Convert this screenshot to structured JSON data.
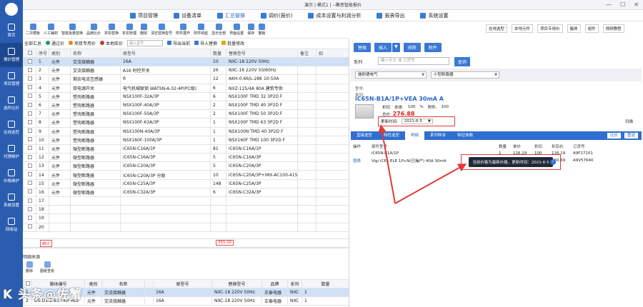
{
  "title": "演示 | 模式1 | --聚思智能报价",
  "window_controls": [
    "—",
    "☐",
    "✕"
  ],
  "sidebar": {
    "items": [
      {
        "label": "首页"
      },
      {
        "label": "报价管理"
      },
      {
        "label": "项目管理"
      },
      {
        "label": "选件比价"
      },
      {
        "label": "在线选型"
      },
      {
        "label": "代理维护"
      },
      {
        "label": "价格维护"
      },
      {
        "label": "系统设置"
      },
      {
        "label": "回收站"
      }
    ]
  },
  "menu": {
    "items": [
      {
        "label": "项目管理"
      },
      {
        "label": "设备清单"
      },
      {
        "label": "汇总替换"
      },
      {
        "label": "调价(报价)"
      },
      {
        "label": "成本设置与利润分析"
      },
      {
        "label": "报表导出"
      },
      {
        "label": "系统设置"
      }
    ],
    "active_index": 2
  },
  "toolbar": {
    "items": [
      "二次模板",
      "人工辅材",
      "智能批量替换",
      "品牌比价",
      "折扣替换",
      "折扣管理",
      "删除",
      "清空替换型号",
      "附件展开",
      "附件收起",
      "显示全部",
      "界面设置",
      "保存",
      "撤销"
    ]
  },
  "right_tools": [
    "在线选型",
    "本地元件",
    "项目专用价",
    "箱体",
    "组件",
    "视频教程"
  ],
  "filterbar": {
    "all": "全部汇总",
    "items": [
      "通过价",
      "项目专用价",
      "本地库价"
    ],
    "input_placeholder": "输入型号",
    "actions": [
      "导出当前",
      "导入替换",
      "批量修改"
    ]
  },
  "main_table": {
    "headers": [
      "",
      "序号",
      "类别",
      "名称",
      "原型号",
      "数量",
      "替换型号",
      "备注",
      "招"
    ],
    "rows": [
      [
        "1",
        "元件",
        "交流接触器",
        "16A",
        "10",
        "NXC-18 220V 50Hz",
        "",
        ""
      ],
      [
        "2",
        "元件",
        "交流接触器",
        "A16 时控开关",
        "26",
        "NXC-16 220V 50/60Hz",
        "",
        ""
      ],
      [
        "3",
        "元件",
        "剩余电流互感器",
        "R",
        "12",
        "AKH-0.66/L-28K 10-50A",
        "",
        ""
      ],
      [
        "4",
        "元件",
        "双电源开关",
        "电气机械联锁 WATSN-A-32-4P(PC级)",
        "6",
        "NXZ-125/4A 80A 建筑专供",
        "",
        ""
      ],
      [
        "5",
        "元件",
        "塑壳断路器",
        "NSX100F-32A/3P",
        "6",
        "NSX100F TMD 32 3P2D F",
        "",
        ""
      ],
      [
        "6",
        "元件",
        "塑壳断路器",
        "NSX100F-40A/3P",
        "2",
        "NSX100F TMD 40 3P2D F",
        "",
        ""
      ],
      [
        "7",
        "元件",
        "塑壳断路器",
        "NSX100F-50A/3P",
        "2",
        "NSX100F TMD 50 3P2D F",
        "",
        ""
      ],
      [
        "8",
        "元件",
        "塑壳断路器",
        "NSX100F-63A/3P",
        "1",
        "NSX100F TMD 63 3P2D F",
        "",
        ""
      ],
      [
        "9",
        "元件",
        "塑壳断路器",
        "NSX100N-40A/3P",
        "1",
        "NSX100N TMD 40 3P2D F",
        "",
        ""
      ],
      [
        "10",
        "元件",
        "塑壳断路器",
        "NSX160F-100A/3P",
        "1",
        "NSX160F TMD 100 3P2D F",
        "",
        ""
      ],
      [
        "11",
        "元件",
        "微型断路器",
        "iC65N-C16A/1P",
        "81",
        "iC65N-C16A/1P",
        "",
        ""
      ],
      [
        "12",
        "元件",
        "微型断路器",
        "iC65N-C16A/3P",
        "5",
        "iC65N-C16A/3P",
        "",
        ""
      ],
      [
        "13",
        "元件",
        "微型断路器",
        "iC65N-C20A/3P",
        "5",
        "iC65N-C20A/3P",
        "",
        ""
      ],
      [
        "14",
        "元件",
        "微型断路器",
        "iC65N-C20A/3P 分励",
        "10",
        "iC65N-C20A/3P+iMX-AC100-415",
        "",
        ""
      ],
      [
        "15",
        "元件",
        "微型断路器",
        "iC65N-C25A/3P",
        "148",
        "iC65N-C25A/3P",
        "",
        ""
      ],
      [
        "16",
        "元件",
        "微型断路器",
        "iC65N-C32A/3P",
        "6",
        "iC65N-C32A/3P",
        "",
        ""
      ],
      [
        "17",
        "",
        "",
        "",
        "",
        "",
        "",
        ""
      ],
      [
        "18",
        "",
        "",
        "",
        "",
        "",
        "",
        ""
      ],
      [
        "19",
        "",
        "",
        "",
        "",
        "",
        "",
        ""
      ],
      [
        "20",
        "",
        "",
        "",
        "",
        "",
        "",
        ""
      ]
    ],
    "selected_index": 0,
    "footer_left": "统计",
    "footer_mid": "355.00"
  },
  "lower": {
    "title": "明细来源",
    "tools": [
      "删除",
      "图纸查看"
    ],
    "headers": [
      "",
      "箱体编号",
      "类别",
      "名称",
      "",
      "原型号",
      "替换型号",
      "品牌",
      "系列",
      "数量"
    ],
    "rows": [
      [
        "1",
        "",
        "元件",
        "交流接触器",
        "",
        "16A",
        "NXC-18 220V 50Hz",
        "正泰电器",
        "NXC",
        "1"
      ],
      [
        "2",
        "DS-D1-Z-B1-TKIF-ALE",
        "元件",
        "交流接触器",
        "",
        "16A",
        "NXC-18 220V 50Hz",
        "正泰电器",
        "NXC",
        "1"
      ]
    ]
  },
  "watermark": "K 头条@佐蟹",
  "right_panel": {
    "buttons": [
      "替换",
      "插入",
      "▼",
      "排除",
      "附件"
    ],
    "series_label": "系列",
    "search_placeholder": "输入中文 或 订货号",
    "search_btn": "查询",
    "brand": "施耐德电气",
    "category": "小型断路器",
    "info_lines": [
      "型号:",
      "系列:"
    ],
    "product_name": "iC65N-B1A/1P+VEA 30mA A",
    "discount_row": {
      "label1": "折扣",
      "label2": "本体:",
      "v1": "100",
      "pct": "%",
      "label3": "附件:",
      "v2": "100"
    },
    "price_label": "总价:",
    "price": "276.88",
    "update_label": "更新时间:",
    "update_date": "2021-6-5",
    "discount_right": "扫描",
    "tabs": [
      "直接选型",
      "特性选型",
      "明细",
      "系列样本",
      "特征参数"
    ],
    "active_tab": 2,
    "tab_btn1": "比价",
    "tab_btn2": "重选",
    "mid_headers": [
      "操作",
      "部件型号",
      "",
      "数量",
      "单价",
      "折扣",
      "折后价",
      "订货号"
    ],
    "mid_rows": [
      [
        "",
        "iC65N-B1A/1P",
        "",
        "1",
        "116.19",
        "100",
        "116.19",
        "A9F17101"
      ],
      [
        "替换",
        "Vigi iC65 ELE 1P+N(已操户) 40A 30mA",
        "",
        "1",
        "160.69",
        "100",
        "160.69",
        "A9V57640"
      ]
    ],
    "tooltip_text": "当前价格为最新价格，更新时间：2021-6-5"
  }
}
